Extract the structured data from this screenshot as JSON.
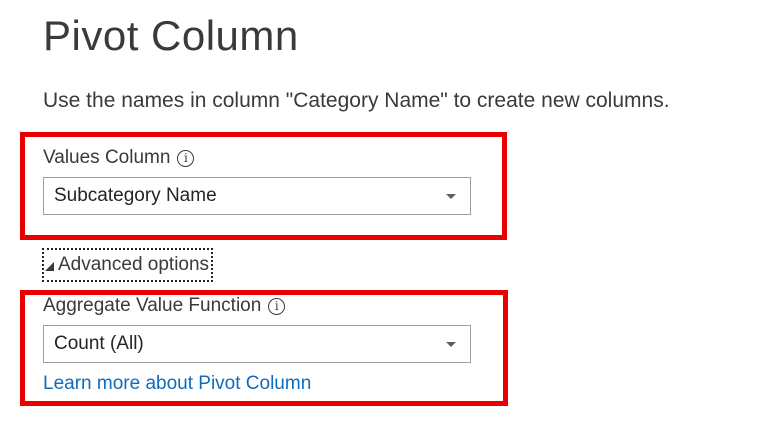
{
  "dialog": {
    "title": "Pivot Column",
    "description": "Use the names in column \"Category Name\" to create new columns."
  },
  "values_column": {
    "label": "Values Column",
    "info_icon": "info-icon",
    "selected": "Subcategory Name"
  },
  "advanced_options": {
    "label": "Advanced options",
    "expanded": true
  },
  "aggregate_function": {
    "label": "Aggregate Value Function",
    "info_icon": "info-icon",
    "selected": "Count (All)"
  },
  "learn_more": {
    "label": "Learn more about Pivot Column"
  },
  "colors": {
    "highlight": "#ea0000",
    "link": "#0f6cbd",
    "text": "#3b3a39"
  }
}
